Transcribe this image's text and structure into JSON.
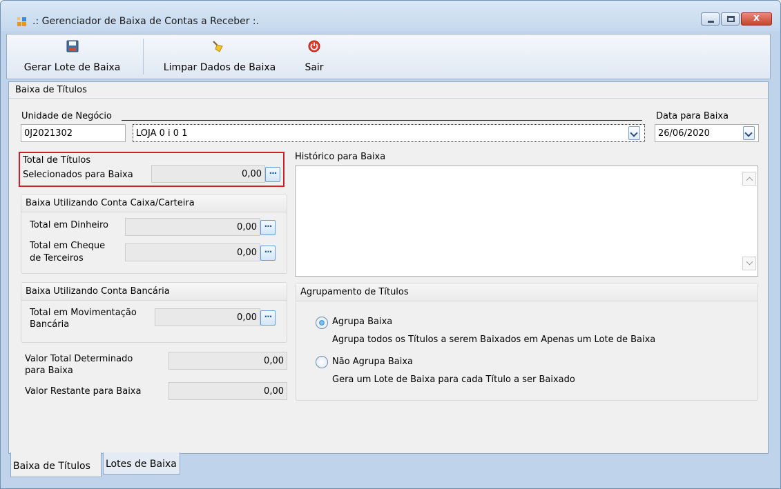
{
  "window": {
    "title": ".: Gerenciador de Baixa de Contas a Receber :.",
    "close_glyph": "x"
  },
  "toolbar": {
    "gerar_label": "Gerar Lote de Baixa",
    "limpar_label": "Limpar Dados de Baixa",
    "sair_label": "Sair",
    "icons": [
      "save-icon",
      "broom-icon",
      "power-icon"
    ]
  },
  "form": {
    "group_title": "Baixa de Títulos",
    "unidade_label": "Unidade de Negócio",
    "unidade_code": "0J2021302",
    "unidade_name": "LOJA 0 i 0 1",
    "data_label": "Data para Baixa",
    "data_value": "26/06/2020",
    "total_titulos_label_1": "Total de Títulos",
    "total_titulos_label_2": "Selecionados para Baixa",
    "total_titulos_value": "0,00",
    "ellipsis": "···",
    "caixa_group_title": "Baixa Utilizando Conta Caixa/Carteira",
    "dinheiro_label": "Total em Dinheiro",
    "dinheiro_value": "0,00",
    "cheque_label_1": "Total em Cheque",
    "cheque_label_2": "de Terceiros",
    "cheque_value": "0,00",
    "bancaria_group_title": "Baixa Utilizando Conta Bancária",
    "mov_label_1": "Total em Movimentação",
    "mov_label_2": "Bancária",
    "mov_value": "0,00",
    "valor_total_label_1": "Valor Total Determinado",
    "valor_total_label_2": "para Baixa",
    "valor_total_value": "0,00",
    "valor_restante_label": "Valor Restante para Baixa",
    "valor_restante_value": "0,00",
    "historico_label": "Histórico para Baixa",
    "historico_value": "",
    "agrupamento_title": "Agrupamento de Títulos",
    "agrupa_label": "Agrupa Baixa",
    "agrupa_desc": "Agrupa todos os Títulos a serem Baixados em Apenas um Lote de Baixa",
    "nao_agrupa_label": "Não Agrupa Baixa",
    "nao_agrupa_desc": "Gera um Lote de Baixa para cada Título a ser Baixado",
    "agrupa_selected": true
  },
  "tabs": {
    "baixa": "Baixa de Títulos",
    "lotes": "Lotes de Baixa",
    "active": "Baixa de Títulos"
  },
  "colors": {
    "highlight": "#d21f25",
    "close_button": "#c7432e"
  }
}
